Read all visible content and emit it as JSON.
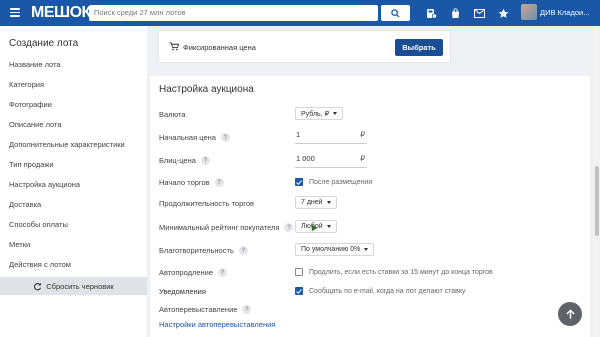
{
  "header": {
    "logo": "МЕШОК",
    "search_placeholder": "Поиск среди 27 млн лотов",
    "user_name": "ДИВ Кладои..."
  },
  "sidebar": {
    "title": "Создание лота",
    "items": [
      {
        "label": "Название лота"
      },
      {
        "label": "Категория"
      },
      {
        "label": "Фотографии"
      },
      {
        "label": "Описание лота"
      },
      {
        "label": "Дополнительные характеристики"
      },
      {
        "label": "Тип продажи"
      },
      {
        "label": "Настройка аукциона"
      },
      {
        "label": "Доставка"
      },
      {
        "label": "Способы оплаты"
      },
      {
        "label": "Метки"
      },
      {
        "label": "Действия с лотом"
      }
    ],
    "reset_label": "Сбросить черновик"
  },
  "fixed_price": {
    "label": "Фиксированная цена",
    "button": "Выбрать"
  },
  "auction": {
    "title": "Настройка аукциона",
    "currency_label": "Валюта",
    "currency_value": "Рубль, ₽",
    "start_price_label": "Начальная цена",
    "start_price_value": "1",
    "blitz_label": "Блиц-цена",
    "blitz_value": "1 000",
    "currency_symbol": "₽",
    "start_label": "Начало торгов",
    "start_option": "После размещения",
    "duration_label": "Продолжительность торгов",
    "duration_value": "7 дней",
    "rating_label": "Минимальный рейтинг покупателя",
    "rating_value": "Любой",
    "charity_label": "Благотворительность",
    "charity_value": "По умолчанию 0%",
    "autoextend_label": "Автопродление",
    "autoextend_option": "Продлить, если есть ставки за 15 минут до конца торгов",
    "notify_label": "Уведомления",
    "notify_option": "Сообщать по e-mail, когда на лот делают ставку",
    "autorelist_label": "Автоперевыставление",
    "autorelist_link": "Настройки автоперевыставления"
  },
  "colors": {
    "brand": "#1a57a6",
    "button": "#1a4e94"
  }
}
